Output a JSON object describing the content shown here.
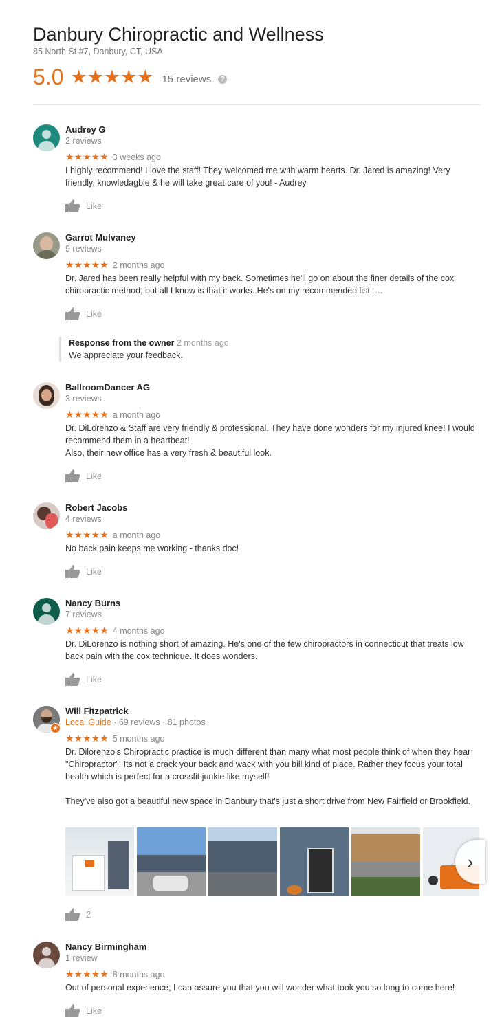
{
  "business": {
    "name": "Danbury Chiropractic and Wellness",
    "address": "85 North St #7, Danbury, CT, USA",
    "rating": "5.0",
    "stars": "★★★★★",
    "review_count": "15 reviews",
    "help_icon": "?"
  },
  "colors": {
    "accent": "#e7711b"
  },
  "reviews": [
    {
      "name": "Audrey G",
      "meta": "2 reviews",
      "stars": "★★★★★",
      "time": "3 weeks ago",
      "text": "I highly recommend! I love the staff! They welcomed me with warm hearts. Dr. Jared is amazing! Very friendly, knowledagble & he will take great care of you! - Audrey",
      "like": "Like",
      "avatar": "generic",
      "avatar_color": "#1e8a7d"
    },
    {
      "name": "Garrot Mulvaney",
      "meta": "9 reviews",
      "stars": "★★★★★",
      "time": "2 months ago",
      "text": "Dr. Jared has been really helpful with my back.  Sometimes he'll go on about the finer details of the cox chiropractic method, but all I know is that it works.  He's on my recommended list. …",
      "like": "Like",
      "avatar": "photo",
      "avatar_color": "#8c8c7a",
      "owner_title": "Response from the owner",
      "owner_time": "2 months ago",
      "owner_text": "We appreciate your feedback."
    },
    {
      "name": "BallroomDancer AG",
      "meta": "3 reviews",
      "stars": "★★★★★",
      "time": "a month ago",
      "text": "Dr. DiLorenzo & Staff are very friendly & professional. They have done wonders for my injured knee! I would recommend them in a heartbeat!\nAlso, their new office has a very fresh & beautiful look.",
      "like": "Like",
      "avatar": "photo",
      "avatar_color": "#6b4a3e"
    },
    {
      "name": "Robert Jacobs",
      "meta": "4 reviews",
      "stars": "★★★★★",
      "time": "a month ago",
      "text": "No back pain keeps me working - thanks doc!",
      "like": "Like",
      "avatar": "photo",
      "avatar_color": "#b86b6b"
    },
    {
      "name": "Nancy Burns",
      "meta": "7 reviews",
      "stars": "★★★★★",
      "time": "4 months ago",
      "text": "Dr. DiLorenzo is nothing short of amazing.  He's one of the few chiropractors in connecticut that treats low back pain with the cox technique.  It does wonders.",
      "like": "Like",
      "avatar": "generic",
      "avatar_color": "#0e5c4a"
    },
    {
      "name": "Will Fitzpatrick",
      "guide": "Local Guide",
      "meta": " · 69 reviews · 81 photos",
      "stars": "★★★★★",
      "time": "5 months ago",
      "text": "Dr. Dilorenzo's Chiropractic practice is much different than many what most people think of when they hear \"Chiropractor\".  Its not a crack your back and wack with you bill kind of place.  Rather they focus your total health which is perfect for a crossfit junkie like myself!\n\nThey've also got a beautiful new space in Danbury that's just a short drive from New Fairfield or Brookfield.",
      "like": "2",
      "avatar": "photo",
      "avatar_color": "#555555"
    },
    {
      "name": "Nancy Birmingham",
      "meta": "1 review",
      "stars": "★★★★★",
      "time": "8 months ago",
      "text": "Out of personal experience, I can assure you that you will wonder what took you so long to come here!",
      "like": "Like",
      "avatar": "generic",
      "avatar_color": "#6b4a3e"
    }
  ],
  "photos": [
    {
      "name": "interior-shelves"
    },
    {
      "name": "building-parking"
    },
    {
      "name": "building-front"
    },
    {
      "name": "entrance-door"
    },
    {
      "name": "street-view"
    },
    {
      "name": "treatment-table"
    }
  ],
  "next_label": "›"
}
